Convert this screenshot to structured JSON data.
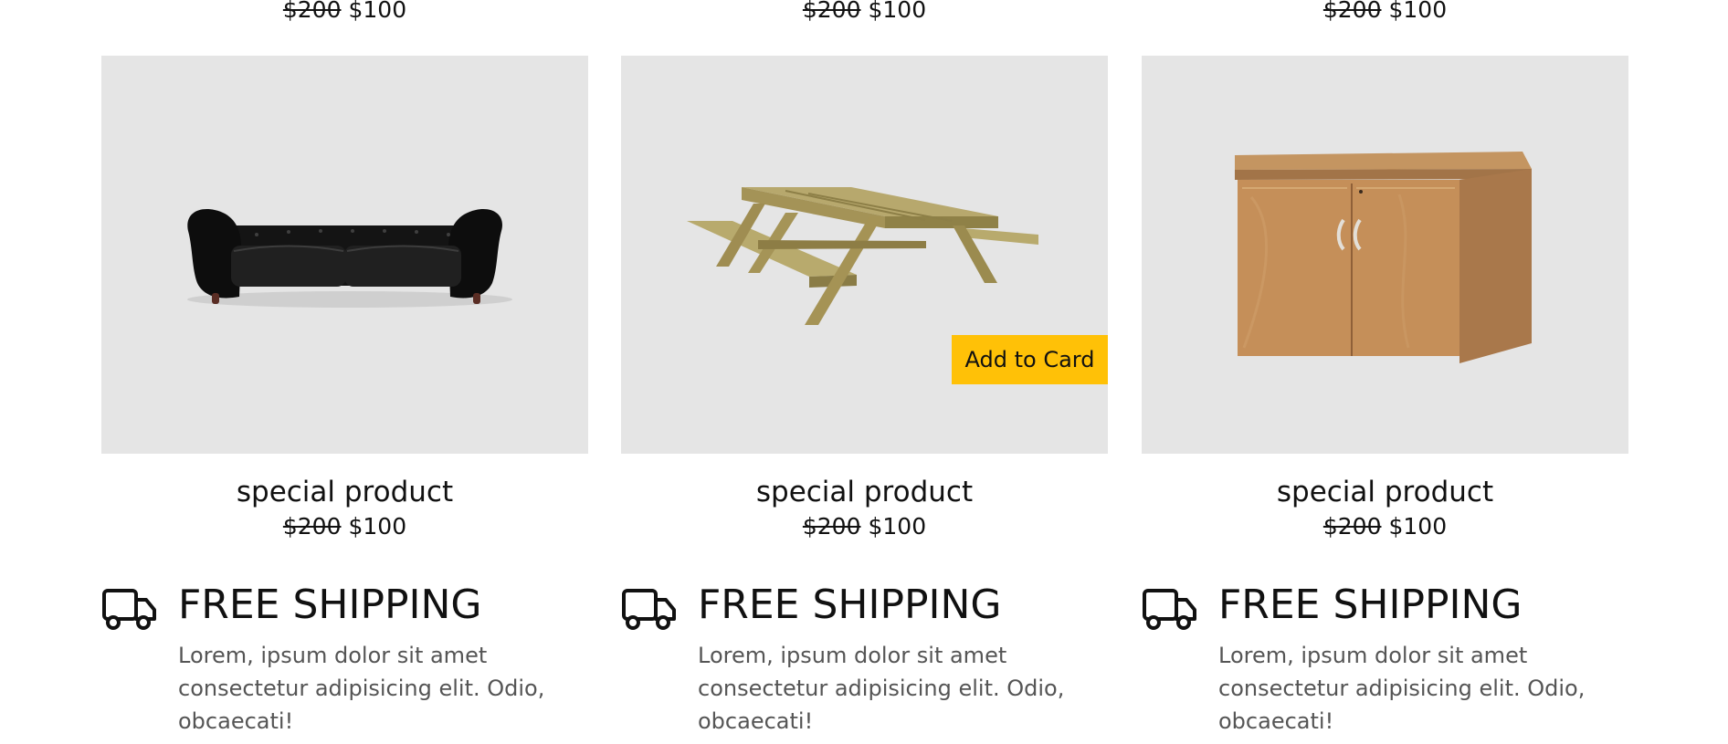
{
  "top_prices": [
    {
      "old": "$200",
      "new": "$100"
    },
    {
      "old": "$200",
      "new": "$100"
    },
    {
      "old": "$200",
      "new": "$100"
    }
  ],
  "products": [
    {
      "title": "special product",
      "old_price": "$200",
      "new_price": "$100",
      "image": "black-leather-sofa"
    },
    {
      "title": "special product",
      "old_price": "$200",
      "new_price": "$100",
      "image": "wooden-picnic-table",
      "button": "Add to Card"
    },
    {
      "title": "special product",
      "old_price": "$200",
      "new_price": "$100",
      "image": "wooden-cabinet"
    }
  ],
  "features": [
    {
      "icon": "truck-icon",
      "title": "FREE SHIPPING",
      "text": "Lorem, ipsum dolor sit amet consectetur adipisicing elit. Odio, obcaecati!"
    },
    {
      "icon": "truck-icon",
      "title": "FREE SHIPPING",
      "text": "Lorem, ipsum dolor sit amet consectetur adipisicing elit. Odio, obcaecati!"
    },
    {
      "icon": "truck-icon",
      "title": "FREE SHIPPING",
      "text": "Lorem, ipsum dolor sit amet consectetur adipisicing elit. Odio, obcaecati!"
    }
  ],
  "colors": {
    "accent": "#ffc107",
    "card_background": "#e5e5e5",
    "text": "#111111",
    "muted_text": "#555555"
  }
}
